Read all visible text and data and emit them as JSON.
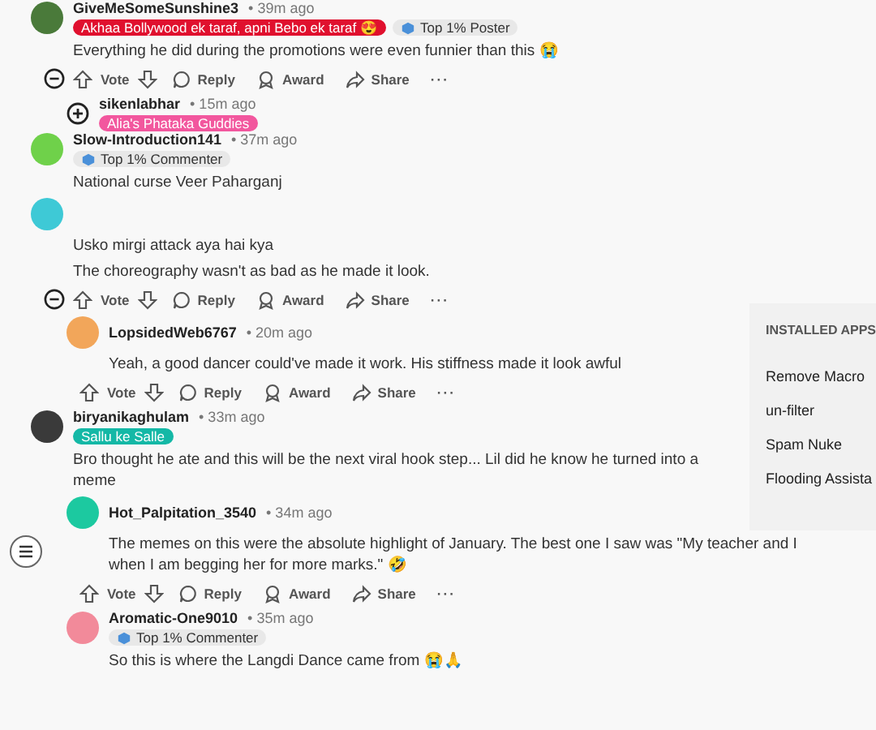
{
  "comments": [
    {
      "user": "GiveMeSomeSunshine3",
      "time": "• 39m ago",
      "color": "#4a7a3a",
      "flairs": [
        {
          "kind": "user",
          "text": "Akhaa Bollywood ek taraf, apni Bebo ek taraf 😍",
          "color": "#e0102e"
        },
        {
          "kind": "achievement",
          "text": "Top 1% Poster"
        }
      ],
      "body": [
        "Everything he did during the promotions were even funnier than this 😭"
      ],
      "expanded": true,
      "actions": {
        "vote": "Vote",
        "reply": "Reply",
        "award": "Award",
        "share": "Share",
        "more": "···"
      },
      "children": [
        {
          "user": "sikenlabhar",
          "time": "• 15m ago",
          "flairs": [
            {
              "kind": "user",
              "text": "Alia's Phataka Guddies",
              "color": "#f2579e"
            }
          ],
          "expanded": false
        }
      ]
    },
    {
      "user": "Slow-Introduction141",
      "time": "• 37m ago",
      "color": "#6fd14a",
      "flairs": [
        {
          "kind": "achievement",
          "text": "Top 1% Commenter"
        }
      ],
      "body": [
        "National curse Veer Paharganj"
      ]
    },
    {
      "color": "#3ec9d6",
      "body": [
        "Usko mirgi attack aya hai kya",
        "The choreography wasn't as bad as he made it look."
      ],
      "expanded": true,
      "actions": {
        "vote": "Vote",
        "reply": "Reply",
        "award": "Award",
        "share": "Share",
        "more": "···"
      },
      "children": [
        {
          "user": "LopsidedWeb6767",
          "time": "• 20m ago",
          "color": "#f2a65a",
          "body": [
            "Yeah, a good dancer could've made it work. His stiffness made it look awful"
          ],
          "actions": {
            "vote": "Vote",
            "reply": "Reply",
            "award": "Award",
            "share": "Share",
            "more": "···"
          }
        }
      ]
    },
    {
      "user": "biryanikaghulam",
      "time": "• 33m ago",
      "color": "#3a3a3a",
      "flairs": [
        {
          "kind": "user",
          "text": "Sallu ke Salle",
          "color": "#14b8a6"
        }
      ],
      "body": [
        "Bro thought he ate and this will be the next viral hook step... Lil did he know he turned into a meme"
      ],
      "children": [
        {
          "user": "Hot_Palpitation_3540",
          "time": "• 34m ago",
          "color": "#1cc9a0",
          "body": [
            "The memes on this were the absolute highlight of January. The best one I saw was \"My teacher and I when I am begging her for more marks.\" 🤣"
          ],
          "actions": {
            "vote": "Vote",
            "reply": "Reply",
            "award": "Award",
            "share": "Share",
            "more": "···"
          }
        },
        {
          "user": "Aromatic-One9010",
          "time": "• 35m ago",
          "color": "#f28a9a",
          "flairs": [
            {
              "kind": "achievement",
              "text": "Top 1% Commenter"
            }
          ],
          "body": [
            "So this is where the Langdi Dance came from 😭🙏"
          ]
        }
      ]
    }
  ],
  "installed_apps": {
    "title": "INSTALLED APPS",
    "items": [
      "Remove Macro",
      "un-filter",
      "Spam Nuke",
      "Flooding Assista"
    ]
  }
}
